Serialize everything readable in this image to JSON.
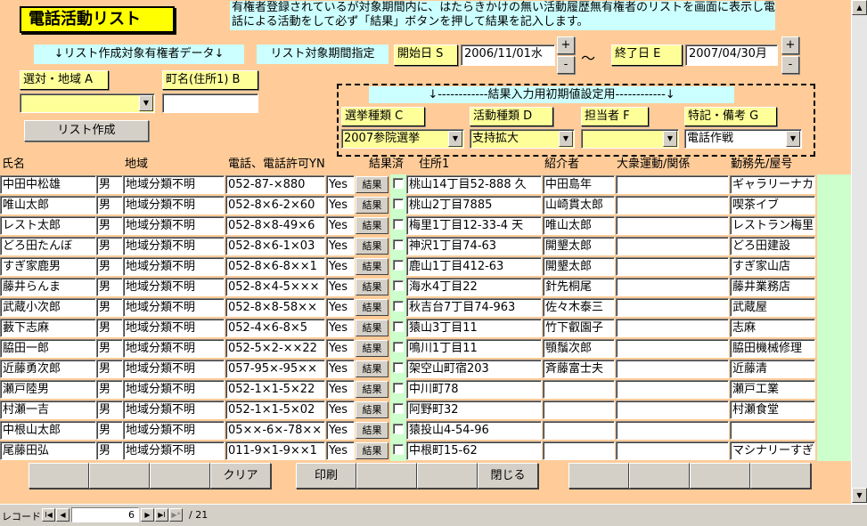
{
  "form": {
    "title": "電話活動リスト",
    "note": "有権者登録されているが対象期間内に、はたらきかけの無い活動履歴無有権者のリストを画面に表示し電話による活動をして必ず「結果」ボタンを押して結果を記入します。",
    "list_target_label": "↓リスト作成対象有権者データ↓",
    "period_label": "リスト対象期間指定",
    "start_label": "開始日 S",
    "start_value": "2006/11/01水",
    "tilde": "～",
    "end_label": "終了日 E",
    "end_value": "2007/04/30月",
    "plus": "+",
    "minus": "-",
    "district_label": "選対・地域 A",
    "town_label": "町名(住所1) B",
    "make_list_button": "リスト作成",
    "init_section_label": "↓------------結果入力用初期値設定用------------↓",
    "election_type_label": "選挙種類 C",
    "election_type_value": "2007参院選挙",
    "activity_type_label": "活動種類 D",
    "activity_type_value": "支持拡大",
    "staff_label": "担当者 F",
    "notes_label": "特記・備考 G",
    "notes_value": "電話作戦"
  },
  "columns": {
    "name": "氏名",
    "region": "地域",
    "phone": "電話、電話許可YN",
    "result_done": "結果済",
    "address": "住所1",
    "referrer": "紹介者",
    "mass_movement": "大衆運動/関係",
    "workplace": "勤務先/屋号"
  },
  "rows": [
    {
      "name": "中田中松雄",
      "sex": "男",
      "region": "地域分類不明",
      "phone": "052-87-×880",
      "yn": "Yes",
      "btn": "結果",
      "addr": "桃山14丁目52-888 久",
      "ref": "中田島年",
      "mass": "",
      "work": "ギャラリーナカ"
    },
    {
      "name": "唯山太郎",
      "sex": "男",
      "region": "地域分類不明",
      "phone": "052-8×6-2×60",
      "yn": "Yes",
      "btn": "結果",
      "addr": "桃山2丁目7885",
      "ref": "山崎貫太郎",
      "mass": "",
      "work": "喫茶イブ"
    },
    {
      "name": "レスト太郎",
      "sex": "男",
      "region": "地域分類不明",
      "phone": "052-8×8-49×6",
      "yn": "Yes",
      "btn": "結果",
      "addr": "梅里1丁目12-33-4 天",
      "ref": "唯山太郎",
      "mass": "",
      "work": "レストラン梅里"
    },
    {
      "name": "どろ田たんぼ",
      "sex": "男",
      "region": "地域分類不明",
      "phone": "052-8×6-1×03",
      "yn": "Yes",
      "btn": "結果",
      "addr": "神沢1丁目74-63",
      "ref": "開墾太郎",
      "mass": "",
      "work": "どろ田建設"
    },
    {
      "name": "すぎ家鹿男",
      "sex": "男",
      "region": "地域分類不明",
      "phone": "052-8×6-8××1",
      "yn": "Yes",
      "btn": "結果",
      "addr": "鹿山1丁目412-63",
      "ref": "開墾太郎",
      "mass": "",
      "work": "すぎ家山店"
    },
    {
      "name": "藤井らんま",
      "sex": "男",
      "region": "地域分類不明",
      "phone": "052-8×4-5×××",
      "yn": "Yes",
      "btn": "結果",
      "addr": "海水4丁目22",
      "ref": "針先桐尾",
      "mass": "",
      "work": "藤井業務店"
    },
    {
      "name": "武蔵小次郎",
      "sex": "男",
      "region": "地域分類不明",
      "phone": "052-8×8-58××",
      "yn": "Yes",
      "btn": "結果",
      "addr": "秋吉台7丁目74-963",
      "ref": "佐々木泰三",
      "mass": "",
      "work": "武蔵屋"
    },
    {
      "name": "藪下志麻",
      "sex": "男",
      "region": "地域分類不明",
      "phone": "052-4×6-8×5",
      "yn": "Yes",
      "btn": "結果",
      "addr": "猿山3丁目11",
      "ref": "竹下叡園子",
      "mass": "",
      "work": "志麻"
    },
    {
      "name": "脇田一郎",
      "sex": "男",
      "region": "地域分類不明",
      "phone": "052-5×2-××22",
      "yn": "Yes",
      "btn": "結果",
      "addr": "鳴川1丁目11",
      "ref": "顎鬚次郎",
      "mass": "",
      "work": "脇田機械修理"
    },
    {
      "name": "近藤勇次郎",
      "sex": "男",
      "region": "地域分類不明",
      "phone": "057-95×-95××",
      "yn": "Yes",
      "btn": "結果",
      "addr": "架空山町宿203",
      "ref": "斉藤富士夫",
      "mass": "",
      "work": "近藤清"
    },
    {
      "name": "瀬戸陸男",
      "sex": "男",
      "region": "地域分類不明",
      "phone": "052-1×1-5×22",
      "yn": "Yes",
      "btn": "結果",
      "addr": "中川町78",
      "ref": "",
      "mass": "",
      "work": "瀬戸工業"
    },
    {
      "name": "村瀬一吉",
      "sex": "男",
      "region": "地域分類不明",
      "phone": "052-1×1-5×02",
      "yn": "Yes",
      "btn": "結果",
      "addr": "阿野町32",
      "ref": "",
      "mass": "",
      "work": "村瀬食堂"
    },
    {
      "name": "中根山太郎",
      "sex": "男",
      "region": "地域分類不明",
      "phone": "05××-6×-78××",
      "yn": "Yes",
      "btn": "結果",
      "addr": "猿投山4-54-96",
      "ref": "",
      "mass": "",
      "work": ""
    },
    {
      "name": "尾藤田弘",
      "sex": "男",
      "region": "地域分類不明",
      "phone": "011-9×1-9××1",
      "yn": "Yes",
      "btn": "結果",
      "addr": "中根町15-62",
      "ref": "",
      "mass": "",
      "work": "マシナリーすぎ"
    }
  ],
  "bottom": {
    "clear": "クリア",
    "print": "印刷",
    "close": "閉じる"
  },
  "nav": {
    "label": "レコード:",
    "first": "I◀",
    "prev": "◀",
    "current": "6",
    "next": "▶",
    "last": "▶I",
    "new": "▶*",
    "total": "/ 21"
  }
}
